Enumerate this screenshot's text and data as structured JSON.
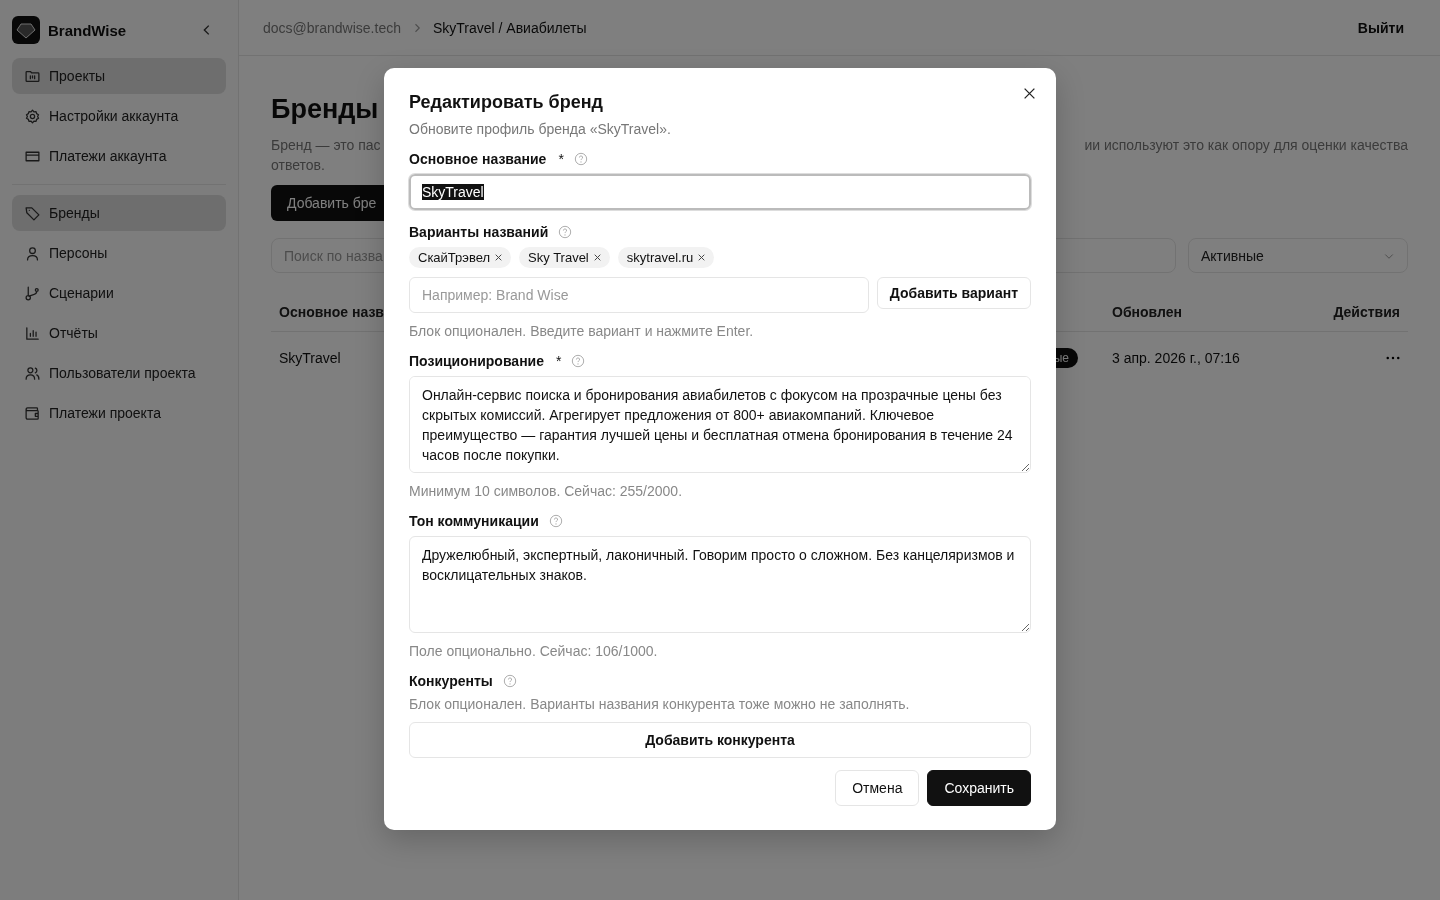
{
  "sidebar": {
    "brand": "BrandWise",
    "groups": [
      [
        {
          "label": "Проекты",
          "selected": true
        },
        {
          "label": "Настройки аккаунта",
          "selected": false
        },
        {
          "label": "Платежи аккаунта",
          "selected": false
        }
      ],
      [
        {
          "label": "Бренды",
          "selected": true
        },
        {
          "label": "Персоны",
          "selected": false
        },
        {
          "label": "Сценарии",
          "selected": false
        },
        {
          "label": "Отчёты",
          "selected": false
        },
        {
          "label": "Пользователи проекта",
          "selected": false
        },
        {
          "label": "Платежи проекта",
          "selected": false
        }
      ]
    ]
  },
  "topbar": {
    "breadcrumbs": [
      "docs@brandwise.tech",
      "SkyTravel / Авиабилеты"
    ],
    "logout": "Выйти"
  },
  "page": {
    "title": "Бренды",
    "description_left": "Бренд — это пас",
    "description_right": "ии используют это как опору для оценки качества",
    "description_line2": "ответов.",
    "add_button": "Добавить бре",
    "search_placeholder": "Поиск по назва",
    "status_filter": "Активные",
    "table": {
      "columns": [
        "Основное назв",
        "Обновлен",
        "Действия"
      ],
      "rows": [
        {
          "name": "SkyTravel",
          "status": "ые",
          "updated": "3 апр. 2026 г., 07:16"
        }
      ]
    }
  },
  "modal": {
    "title": "Редактировать бренд",
    "subtitle": "Обновите профиль бренда «SkyTravel».",
    "fields": [
      {
        "kind": "text",
        "label": "Основное название",
        "required_mark": "*",
        "value": "SkyTravel",
        "focused": true,
        "text_highlighted": true
      },
      {
        "kind": "tags",
        "label": "Варианты названий",
        "tags": [
          "СкайТрэвел",
          "Sky Travel",
          "skytravel.ru"
        ],
        "placeholder": "Например: Brand Wise",
        "button": "Добавить вариант",
        "hint": "Блок опционален. Введите вариант и нажмите Enter."
      },
      {
        "kind": "textarea",
        "label": "Позиционирование",
        "required_mark": "*",
        "value": "Онлайн-сервис поиска и бронирования авиабилетов с фокусом на прозрачные цены без скрытых комиссий. Агрегирует предложения от 800+ авиакомпаний. Ключевое преимущество — гарантия лучшей цены и бесплатная отмена бронирования в течение 24 часов после покупки.",
        "hint": "Минимум 10 символов. Сейчас: 255/2000."
      },
      {
        "kind": "textarea",
        "label": "Тон коммуникации",
        "value": "Дружелюбный, экспертный, лаконичный. Говорим просто о сложном. Без канцеляризмов и восклицательных знаков.",
        "hint": "Поле опционально. Сейчас: 106/1000."
      },
      {
        "kind": "list",
        "label": "Конкуренты",
        "hint": "Блок опционален. Варианты названия конкурента тоже можно не заполнять.",
        "button": "Добавить конкурента"
      }
    ],
    "buttons": [
      {
        "kind": "secondary",
        "label": "Отмена"
      },
      {
        "kind": "primary",
        "label": "Сохранить"
      }
    ]
  }
}
